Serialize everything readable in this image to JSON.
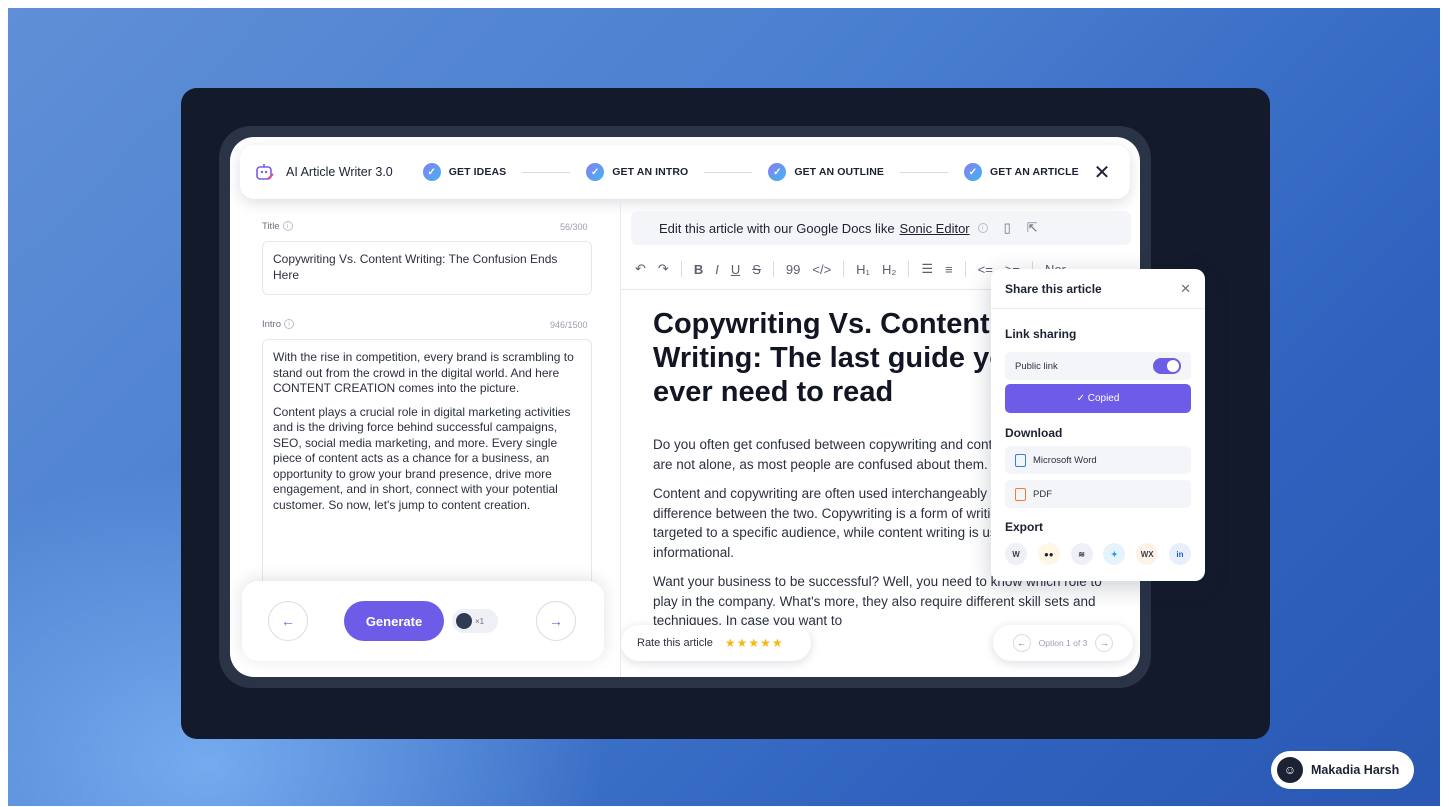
{
  "header": {
    "app_title": "AI Article Writer 3.0",
    "steps": [
      "GET IDEAS",
      "GET AN INTRO",
      "GET AN OUTLINE",
      "GET AN ARTICLE"
    ],
    "close_icon": "close-icon"
  },
  "left": {
    "title_label": "Title",
    "title_count": "56/300",
    "title_value": "Copywriting Vs. Content Writing: The Confusion Ends Here",
    "intro_label": "Intro",
    "intro_count": "946/1500",
    "intro_p1": "With the rise in competition, every brand is scrambling to stand out from the crowd in the digital world. And here CONTENT CREATION comes into the picture.",
    "intro_p2": "Content plays a crucial role in digital marketing activities and is the driving force behind successful campaigns, SEO, social media marketing, and more. Every single piece of content acts as a chance for a business, an opportunity to grow your brand presence, drive more engagement, and in short, connect with your potential customer. So now, let's jump to content creation.",
    "generate_label": "Generate",
    "credit_label": "×1"
  },
  "right": {
    "edit_text": "Edit this article with our Google Docs like",
    "edit_link": "Sonic Editor",
    "toolbar": {
      "undo": "↶",
      "redo": "↷",
      "bold": "B",
      "italic": "I",
      "underline": "U",
      "strike": "S",
      "quote": "99",
      "code": "</>",
      "h1": "H₁",
      "h2": "H₂",
      "ul": "☰",
      "ol": "≡",
      "outdent": "<=",
      "indent": ">=",
      "style": "Nor"
    },
    "article_title": "Copywriting Vs. Content Writing: The last guide you'll ever need to read",
    "p1": "Do you often get confused between copywriting and content writing? Well, you are not alone, as most people are confused about them.",
    "p2": "Content and copywriting are often used interchangeably but there's a lot of difference between the two. Copywriting is a form of writing persuasive and targeted to a specific audience, while content writing is usually more informational.",
    "p3": "Want your business to be successful? Well, you need to know which role to play in the company. What's more, they also require different skill sets and techniques. In case you want to",
    "rate_label": "Rate this article",
    "stars": "★★★★★",
    "option_label": "Option 1 of 3"
  },
  "share": {
    "title": "Share this article",
    "link_sharing": "Link sharing",
    "public_link": "Public link",
    "copied": "✓ Copied",
    "download": "Download",
    "word": "Microsoft Word",
    "pdf": "PDF",
    "export": "Export",
    "export_icons": [
      {
        "name": "wordpress-icon",
        "glyph": "W",
        "bg": "#eef0f5",
        "fg": "#3a3f4d"
      },
      {
        "name": "medium-icon",
        "glyph": "●●",
        "bg": "#fff6e6",
        "fg": "#1c2233"
      },
      {
        "name": "webflow-icon",
        "glyph": "≋",
        "bg": "#eef0f5",
        "fg": "#3a3f4d"
      },
      {
        "name": "twitter-icon",
        "glyph": "✦",
        "bg": "#e6f3fd",
        "fg": "#1d9bf0"
      },
      {
        "name": "wix-icon",
        "glyph": "WX",
        "bg": "#fff3e9",
        "fg": "#3a3f4d"
      },
      {
        "name": "linkedin-icon",
        "glyph": "in",
        "bg": "#e8eefb",
        "fg": "#1f5fc4"
      }
    ]
  },
  "badge": {
    "name": "Makadia Harsh"
  },
  "colors": {
    "accent": "#6c5ce7",
    "dark": "#131a2b"
  }
}
